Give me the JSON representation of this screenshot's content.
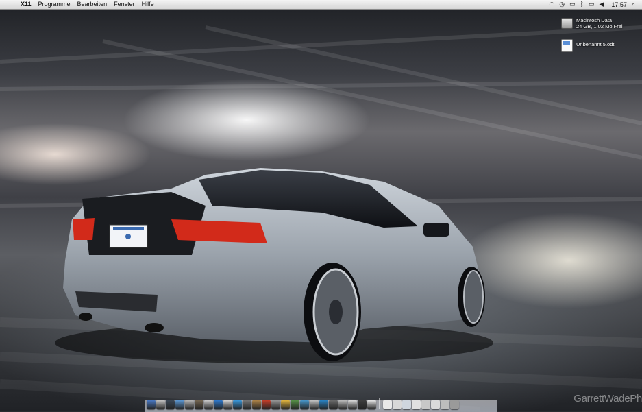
{
  "menubar": {
    "apple_icon": "",
    "app_name": "X11",
    "items": [
      "Programme",
      "Bearbeiten",
      "Fenster",
      "Hilfe"
    ],
    "status_icons": [
      "wifi-icon",
      "time-machine-icon",
      "display-icon",
      "bluetooth-icon",
      "battery-icon",
      "volume-icon"
    ],
    "clock": "17:57",
    "spotlight_icon": "search-icon"
  },
  "desktop_icons": [
    {
      "name": "Macintosh Data",
      "detail": "24 GB, 1.02 Mo Frei",
      "icon": "hard-drive-icon"
    },
    {
      "name": "Unbenannt 5.odt",
      "icon": "document-icon"
    }
  ],
  "dock": {
    "item_colors": [
      "#4b7fd0",
      "#cfcfcf",
      "#3d4a5a",
      "#5fa0e0",
      "#c0c0c0",
      "#7a6b55",
      "#d8d8d8",
      "#2f7fd8",
      "#e0e0e0",
      "#3aa0e8",
      "#7c7c7c",
      "#b88a4a",
      "#d0402a",
      "#a0a0a0",
      "#f0c040",
      "#5a9a4a",
      "#4aa0d8",
      "#d0d0d0",
      "#2a8ad0",
      "#707070",
      "#c8c8c8",
      "#e8e8e8",
      "#404040",
      "#f4f4f4"
    ],
    "stack_colors": [
      "#e8e8e8",
      "#d8d8d8",
      "#cfd6de",
      "#e0e0e0",
      "#c8c8c8",
      "#dadada",
      "#bdbdbd",
      "#9a9a9a"
    ]
  },
  "watermark": "GarrettWadePh"
}
